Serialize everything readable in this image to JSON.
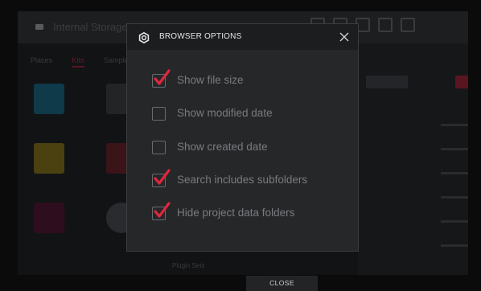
{
  "background": {
    "path_text": "Internal Storage",
    "tabs": [
      {
        "label": "Places",
        "active": false
      },
      {
        "label": "Kits",
        "active": true
      },
      {
        "label": "Samples",
        "active": false
      }
    ],
    "plugin_label": "Plugin Sets"
  },
  "dialog": {
    "title": "BROWSER OPTIONS",
    "icon": "gear-icon",
    "options": [
      {
        "label": "Show file size",
        "checked": true
      },
      {
        "label": "Show modified date",
        "checked": false
      },
      {
        "label": "Show created date",
        "checked": false
      },
      {
        "label": "Search includes subfolders",
        "checked": true
      },
      {
        "label": "Hide project data folders",
        "checked": true
      }
    ]
  },
  "footer": {
    "close_label": "CLOSE"
  },
  "colors": {
    "accent": "#e0273d",
    "dialog_bg": "#262729",
    "header_bg": "#1c1d1f"
  }
}
